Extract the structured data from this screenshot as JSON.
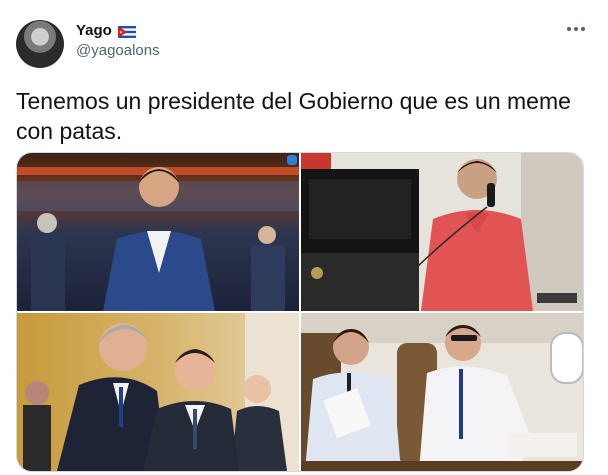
{
  "user": {
    "display_name": "Yago",
    "handle": "@yagoalons",
    "flag_icon": "cuba-flag-icon"
  },
  "more_icon": "more-horizontal-icon",
  "tweet": {
    "text": "Tenemos un presidente del Gobierno que es un meme con patas."
  },
  "media": {
    "photos": [
      {
        "name": "photo-smiling-in-arena"
      },
      {
        "name": "photo-on-phone-at-desk"
      },
      {
        "name": "photo-with-king-at-palace"
      },
      {
        "name": "photo-on-airplane"
      }
    ]
  }
}
